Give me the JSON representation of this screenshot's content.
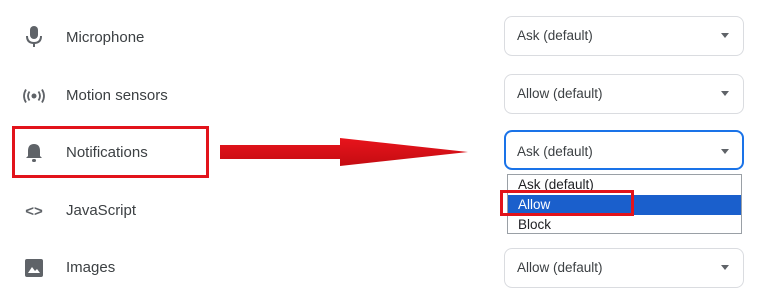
{
  "rows": [
    {
      "label": "Microphone",
      "icon": "microphone-icon",
      "value": "Ask (default)"
    },
    {
      "label": "Motion sensors",
      "icon": "motion-sensors-icon",
      "value": "Allow (default)"
    },
    {
      "label": "Notifications",
      "icon": "bell-icon",
      "value": "Ask (default)"
    },
    {
      "label": "JavaScript",
      "icon": "code-icon"
    },
    {
      "label": "Images",
      "icon": "image-icon",
      "value": "Allow (default)"
    }
  ],
  "dropdown": {
    "options": [
      "Ask (default)",
      "Allow",
      "Block"
    ],
    "highlighted": "Allow"
  },
  "colors": {
    "annotation": "#e2131b",
    "focus": "#1a73e8",
    "selected_option": "#1a5fcc"
  }
}
